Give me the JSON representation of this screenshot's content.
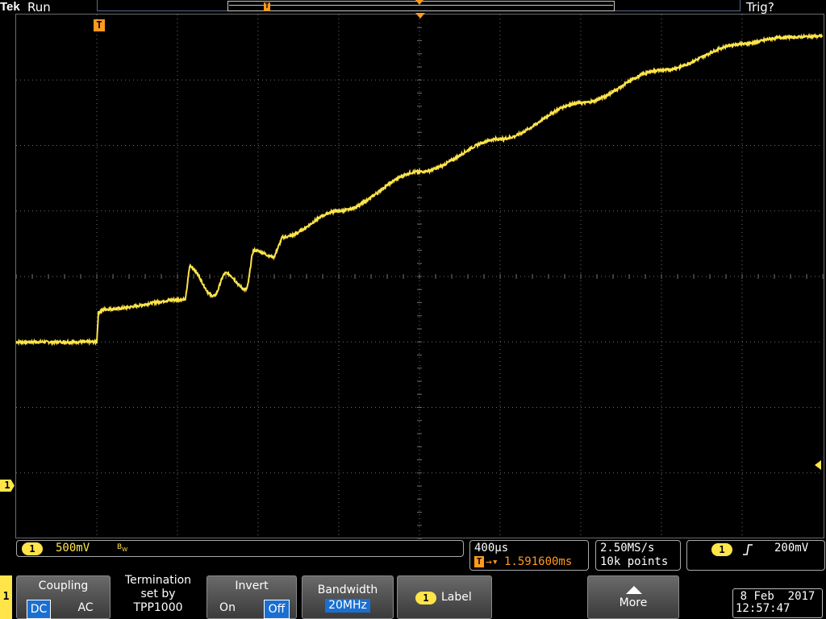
{
  "header": {
    "brand": "Tek",
    "run_state": "Run",
    "trigger_state": "Trig?"
  },
  "markers": {
    "trigger": "T",
    "ch1": "1"
  },
  "status": {
    "ch1_pill": "1",
    "ch1_scale": "500mV",
    "bw_limit_icon": "bandwidth-limit-icon",
    "time_per_div": "400µs",
    "trigger_delay": "1.591600ms",
    "sample_rate": "2.50MS/s",
    "record_length": "10k points",
    "trig_source": "1",
    "trig_slope": "rising-edge-icon",
    "trig_level": "200mV"
  },
  "menu": {
    "side_channel": "1",
    "coupling": {
      "title": "Coupling",
      "opt_dc": "DC",
      "opt_ac": "AC",
      "selected": "DC"
    },
    "termination": {
      "line1": "Termination",
      "line2": "set by",
      "line3": "TPP1000"
    },
    "invert": {
      "title": "Invert",
      "opt_on": "On",
      "opt_off": "Off",
      "selected": "Off"
    },
    "bandwidth": {
      "title": "Bandwidth",
      "value": "20MHz"
    },
    "label": {
      "pill": "1",
      "text": "Label"
    },
    "more": {
      "text": "More"
    }
  },
  "datetime": {
    "date": "8 Feb  2017",
    "time": "12:57:47"
  },
  "colors": {
    "trace": "#ffe54a",
    "trigger_marker": "#ff9a1e",
    "grid": "#6b6b6b",
    "selection": "#1a6fd0"
  },
  "waveform": {
    "description_points_div": [
      [
        0.0,
        3.0
      ],
      [
        1.0,
        3.0
      ],
      [
        1.02,
        3.45
      ],
      [
        1.1,
        3.5
      ],
      [
        2.1,
        3.65
      ],
      [
        2.15,
        4.15
      ],
      [
        2.45,
        3.7
      ],
      [
        2.6,
        4.05
      ],
      [
        2.85,
        3.8
      ],
      [
        2.95,
        4.4
      ],
      [
        3.2,
        4.3
      ],
      [
        3.3,
        4.6
      ],
      [
        4.0,
        5.0
      ],
      [
        5.0,
        5.6
      ],
      [
        6.0,
        6.1
      ],
      [
        7.0,
        6.65
      ],
      [
        8.0,
        7.15
      ],
      [
        9.0,
        7.55
      ],
      [
        9.5,
        7.65
      ],
      [
        10.0,
        7.67
      ]
    ]
  }
}
